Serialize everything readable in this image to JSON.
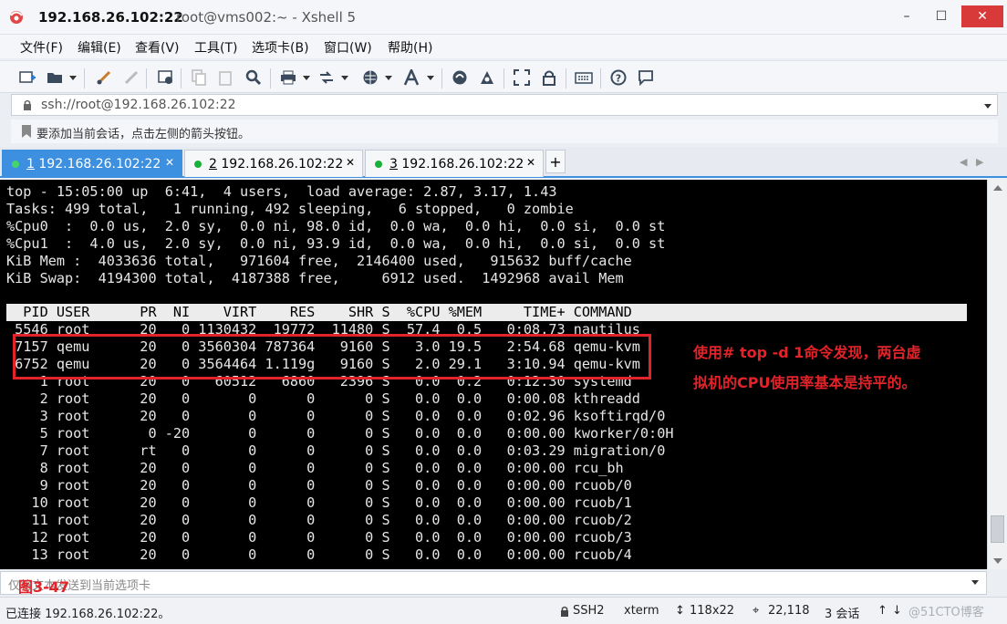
{
  "window": {
    "host": "192.168.26.102:22",
    "subtitle": "root@vms002:~ - Xshell 5",
    "min_glyph": "–",
    "max_glyph": "☐",
    "close_glyph": "✕"
  },
  "menu": [
    "文件(F)",
    "编辑(E)",
    "查看(V)",
    "工具(T)",
    "选项卡(B)",
    "窗口(W)",
    "帮助(H)"
  ],
  "toolbar": {
    "icons": [
      "new-session-icon",
      "open-folder-icon",
      "reconnect-icon",
      "disconnect-icon",
      "properties-icon",
      "copy-icon",
      "paste-icon",
      "find-icon",
      "print-icon",
      "transfer-icon",
      "globe-icon",
      "font-icon",
      "xftp-icon",
      "xmanager-icon",
      "fullscreen-icon",
      "lock-icon",
      "keyboard-icon",
      "help-icon",
      "chat-icon"
    ]
  },
  "address": {
    "value": "ssh://root@192.168.26.102:22"
  },
  "hint": {
    "text": "要添加当前会话，点击左侧的箭头按钮。"
  },
  "tabs": [
    {
      "num": "1",
      "label": "192.168.26.102:22",
      "close": "✕"
    },
    {
      "num": "2",
      "label": "192.168.26.102:22",
      "close": "✕"
    },
    {
      "num": "3",
      "label": "192.168.26.102:22",
      "close": "✕"
    }
  ],
  "tab_add": "+",
  "tab_nav_left": "◀",
  "tab_nav_right": "▶",
  "terminal": {
    "lines": [
      "top - 15:05:00 up  6:41,  4 users,  load average: 2.87, 3.17, 1.43",
      "Tasks: 499 total,   1 running, 492 sleeping,   6 stopped,   0 zombie",
      "%Cpu0  :  0.0 us,  2.0 sy,  0.0 ni, 98.0 id,  0.0 wa,  0.0 hi,  0.0 si,  0.0 st",
      "%Cpu1  :  4.0 us,  2.0 sy,  0.0 ni, 93.9 id,  0.0 wa,  0.0 hi,  0.0 si,  0.0 st",
      "KiB Mem :  4033636 total,   971604 free,  2146400 used,   915632 buff/cache",
      "KiB Swap:  4194300 total,  4187388 free,     6912 used.  1492968 avail Mem"
    ],
    "header": "  PID USER      PR  NI    VIRT    RES    SHR S  %CPU %MEM     TIME+ COMMAND",
    "rows": [
      " 5546 root      20   0 1130432  19772  11480 S  57.4  0.5   0:08.73 nautilus",
      " 7157 qemu      20   0 3560304 787364   9160 S   3.0 19.5   2:54.68 qemu-kvm",
      " 6752 qemu      20   0 3564464 1.119g   9160 S   2.0 29.1   3:10.94 qemu-kvm",
      "    1 root      20   0   60512   6860   2396 S   0.0  0.2   0:12.30 systemd",
      "    2 root      20   0       0      0      0 S   0.0  0.0   0:00.08 kthreadd",
      "    3 root      20   0       0      0      0 S   0.0  0.0   0:02.96 ksoftirqd/0",
      "    5 root       0 -20       0      0      0 S   0.0  0.0   0:00.00 kworker/0:0H",
      "    7 root      rt   0       0      0      0 S   0.0  0.0   0:03.29 migration/0",
      "    8 root      20   0       0      0      0 S   0.0  0.0   0:00.00 rcu_bh",
      "    9 root      20   0       0      0      0 S   0.0  0.0   0:00.00 rcuob/0",
      "   10 root      20   0       0      0      0 S   0.0  0.0   0:00.00 rcuob/1",
      "   11 root      20   0       0      0      0 S   0.0  0.0   0:00.00 rcuob/2",
      "   12 root      20   0       0      0      0 S   0.0  0.0   0:00.00 rcuob/3",
      "   13 root      20   0       0      0      0 S   0.0  0.0   0:00.00 rcuob/4"
    ]
  },
  "annotation": {
    "line1": "使用# top -d 1命令发现，两台虚",
    "line2": "拟机的CPU使用率基本是持平的。",
    "figure_label": "图3-47",
    "color": "#e2232a"
  },
  "sendbar": {
    "text": "仅将文本发送到当前选项卡"
  },
  "status": {
    "connected": "已连接 192.168.26.102:22。",
    "protocol": "SSH2",
    "term": "xterm",
    "size": "118x22",
    "cursor": "22,118",
    "sessions": "3 会话",
    "watermark": "@51CTO博客"
  },
  "colors": {
    "tab_active": "#3d8fdf",
    "session_dot": "#18b13a"
  }
}
